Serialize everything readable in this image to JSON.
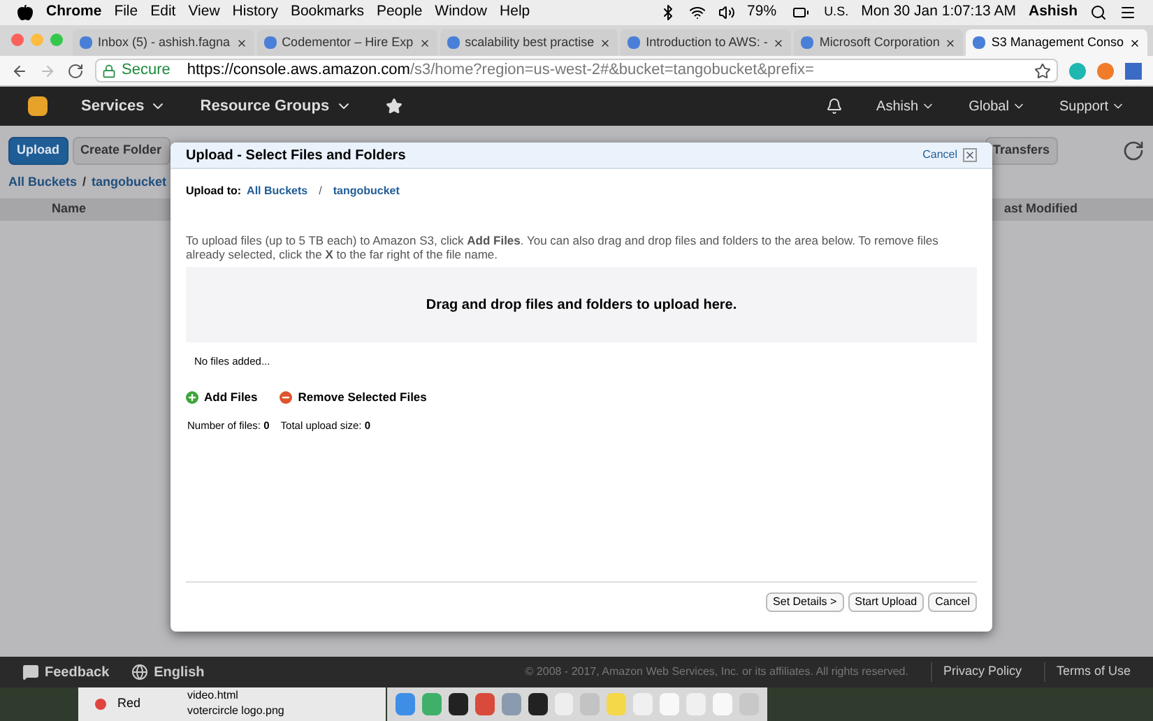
{
  "menubar": {
    "app": "Chrome",
    "items": [
      "File",
      "Edit",
      "View",
      "History",
      "Bookmarks",
      "People",
      "Window",
      "Help"
    ],
    "battery": "79%",
    "input": "U.S.",
    "clock": "Mon 30 Jan  1:07:13 AM",
    "user": "Ashish"
  },
  "tabs": [
    {
      "label": "Inbox (5) - ashish.fagna",
      "selected": false
    },
    {
      "label": "Codementor – Hire Exp",
      "selected": false
    },
    {
      "label": "scalability best practise",
      "selected": false
    },
    {
      "label": "Introduction to AWS: -",
      "selected": false
    },
    {
      "label": "Microsoft Corporation",
      "selected": false
    },
    {
      "label": "S3 Management Conso",
      "selected": true
    }
  ],
  "address": {
    "secure": "Secure",
    "host": "https://console.aws.amazon.com",
    "path": "/s3/home?region=us-west-2#&bucket=tangobucket&prefix="
  },
  "aws_nav": {
    "items": [
      "Services",
      "Resource Groups"
    ],
    "right": [
      "Ashish",
      "Global",
      "Support"
    ]
  },
  "toolbar": [
    {
      "label": "Upload",
      "kind": "primary"
    },
    {
      "label": "Create Folder",
      "kind": "default"
    },
    {
      "label": "Transfers",
      "kind": "default"
    }
  ],
  "breadcrumb": {
    "items": [
      "All Buckets",
      "tangobucket"
    ],
    "separator": "/"
  },
  "table_columns": [
    "Name",
    "ast Modified"
  ],
  "dialog": {
    "title": "Upload - Select Files and Folders",
    "close": "Cancel",
    "upload_to": "Upload to:",
    "path": [
      "All Buckets",
      "tangobucket"
    ],
    "separator": "/",
    "instructions": "To upload files (up to 5 TB each) to Amazon S3, click **Add Files**. You can also drag and drop files and folders to the area below. To remove files already selected, click the **X** to the far right of the file name.",
    "drop_zone": "Drag and drop files and folders to upload here.",
    "empty": "No files added...",
    "actions": [
      {
        "kind": "add",
        "label": "Add Files"
      },
      {
        "kind": "remove",
        "label": "Remove Selected Files"
      }
    ],
    "stats": [
      {
        "label": "Number of files:",
        "value": "0"
      },
      {
        "label": "Total upload size:",
        "value": "0"
      }
    ],
    "buttons": [
      "Set Details >",
      "Start Upload",
      "Cancel"
    ]
  },
  "footer": {
    "feedback": "Feedback",
    "language": "English",
    "copyright": "© 2008 - 2017, Amazon Web Services, Inc. or its affiliates. All rights reserved.",
    "links": [
      "Privacy Policy",
      "Terms of Use"
    ]
  },
  "finder": {
    "tag": {
      "label": "Red",
      "color": "#e0443e"
    },
    "files": [
      "video.html",
      "votercircle logo.png"
    ]
  }
}
